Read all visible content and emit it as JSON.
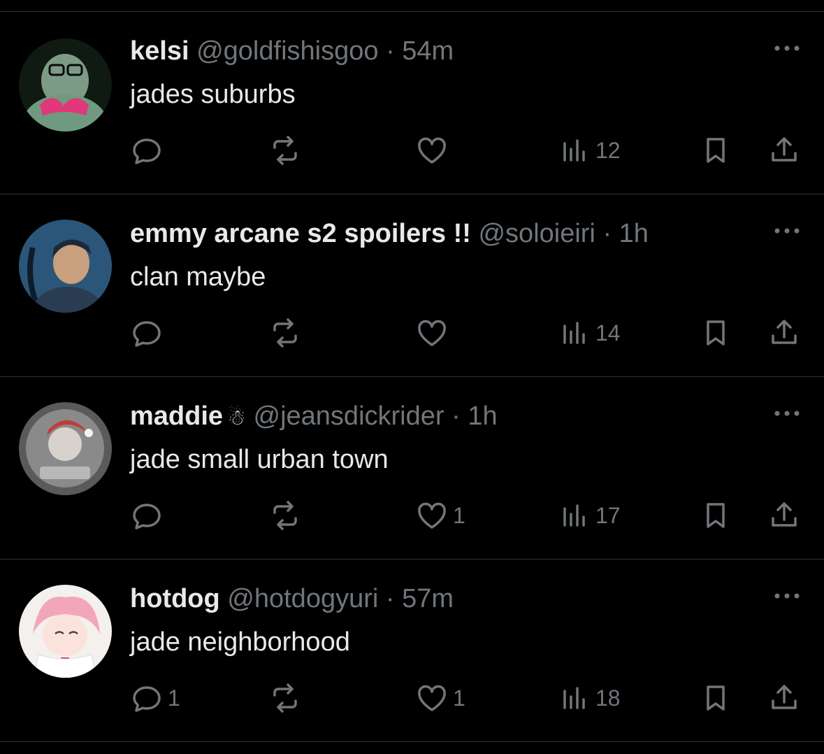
{
  "posts": [
    {
      "name": "kelsi",
      "handle": "@goldfishisgoo",
      "sep": "·",
      "time": "54m",
      "emoji": "",
      "text": "jades suburbs",
      "replies": "",
      "likes": "",
      "views": "12",
      "avatar_colors": [
        "#0f1a12",
        "#8fb29a",
        "#e0387a"
      ]
    },
    {
      "name": "emmy arcane s2 spoilers !!",
      "handle": "@soloieiri",
      "sep": "·",
      "time": "1h",
      "emoji": "",
      "text": "clan maybe",
      "replies": "",
      "likes": "",
      "views": "14",
      "avatar_colors": [
        "#1c3550",
        "#3f7eaa",
        "#c9a07e"
      ]
    },
    {
      "name": "maddie",
      "handle": "@jeansdickrider",
      "sep": "·",
      "time": "1h",
      "emoji": "☃",
      "text": "jade small urban town",
      "replies": "",
      "likes": "1",
      "views": "17",
      "avatar_colors": [
        "#5a5a5a",
        "#b8b8b8",
        "#c23a3a"
      ]
    },
    {
      "name": "hotdog",
      "handle": "@hotdogyuri",
      "sep": "·",
      "time": "57m",
      "emoji": "",
      "text": "jade neighborhood",
      "replies": "1",
      "likes": "1",
      "views": "18",
      "avatar_colors": [
        "#f3f0ee",
        "#f2a7b8",
        "#c8202a"
      ]
    }
  ],
  "theme": {
    "background": "#000000",
    "text": "#e7e9ea",
    "muted": "#71767b",
    "divider": "#2f3336"
  }
}
